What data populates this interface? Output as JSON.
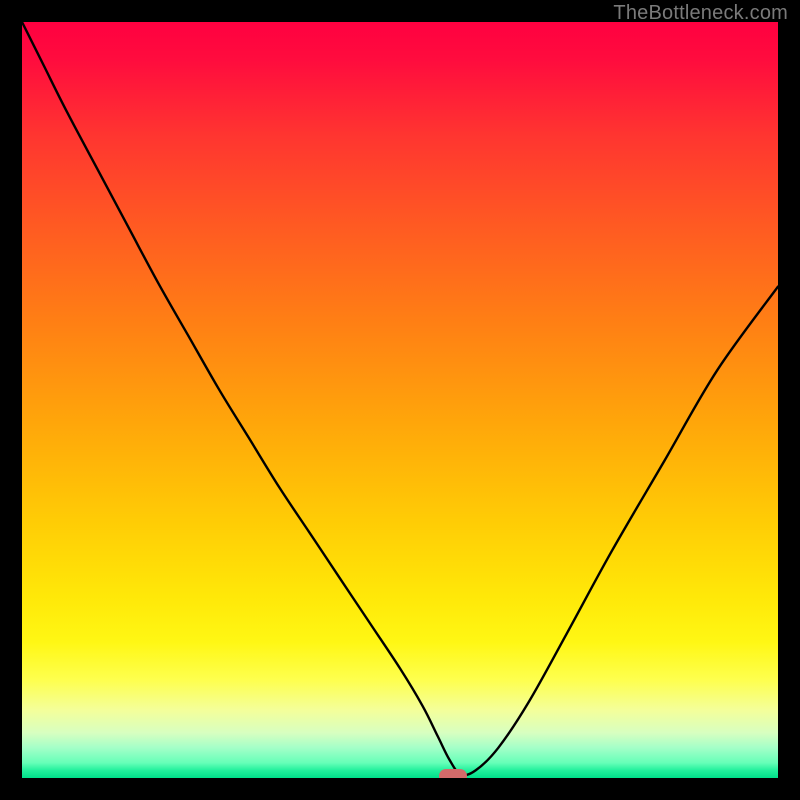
{
  "credit": "TheBottleneck.com",
  "chart_data": {
    "type": "line",
    "title": "",
    "xlabel": "",
    "ylabel": "",
    "xlim": [
      0,
      100
    ],
    "ylim": [
      0,
      100
    ],
    "x": [
      0,
      3,
      6,
      10,
      14,
      18,
      22,
      26,
      30,
      34,
      38,
      42,
      46,
      50,
      53,
      55,
      56.5,
      58,
      60,
      63,
      67,
      72,
      78,
      85,
      92,
      100
    ],
    "y": [
      100,
      94,
      88,
      80.5,
      73,
      65.5,
      58.5,
      51.5,
      45,
      38.5,
      32.5,
      26.5,
      20.5,
      14.5,
      9.5,
      5.5,
      2.5,
      0.5,
      1,
      4,
      10,
      19,
      30,
      42,
      54,
      65
    ],
    "marker": {
      "x": 57,
      "y": 0.3
    },
    "gradient_stops": [
      {
        "pos": 0,
        "color": "#ff0040"
      },
      {
        "pos": 50,
        "color": "#ff9a10"
      },
      {
        "pos": 80,
        "color": "#fff020"
      },
      {
        "pos": 100,
        "color": "#00e08a"
      }
    ]
  }
}
